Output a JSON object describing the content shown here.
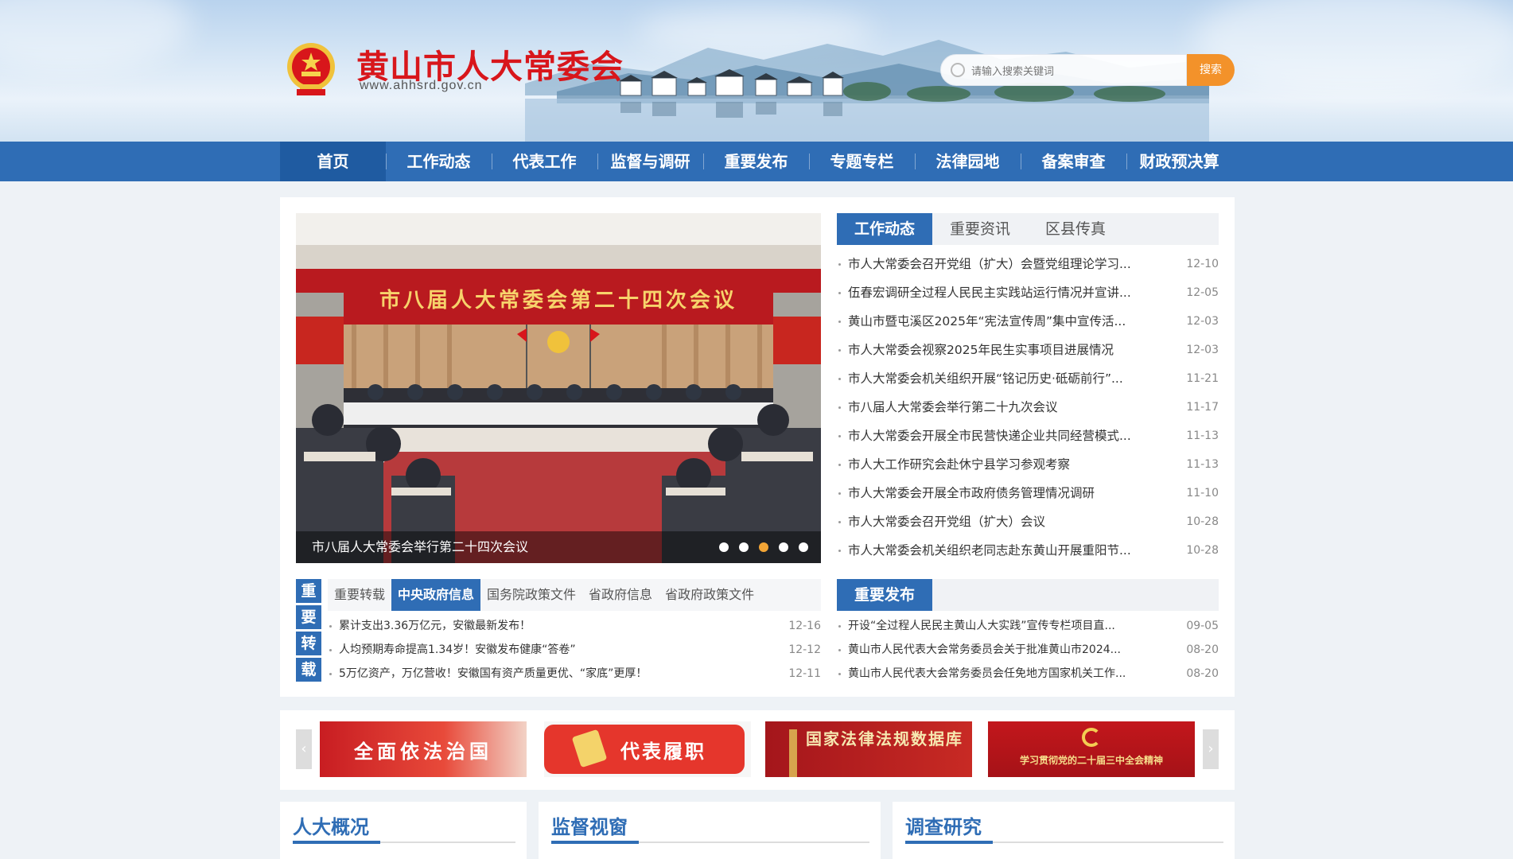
{
  "header": {
    "site_title": "黄山市人大常委会",
    "site_domain": "www.ahhsrd.gov.cn",
    "search_placeholder": "请输入搜索关键词",
    "search_button": "搜索"
  },
  "nav": [
    {
      "label": "首页",
      "active": true
    },
    {
      "label": "工作动态"
    },
    {
      "label": "代表工作"
    },
    {
      "label": "监督与调研"
    },
    {
      "label": "重要发布"
    },
    {
      "label": "专题专栏"
    },
    {
      "label": "法律园地"
    },
    {
      "label": "备案审查"
    },
    {
      "label": "财政预决算"
    }
  ],
  "slider": {
    "banner_text": "市八届人大常委会第二十四次会议",
    "caption": "市八届人大常委会举行第二十四次会议",
    "active_dot": 2,
    "dot_count": 5
  },
  "news_tabs": [
    "工作动态",
    "重要资讯",
    "区县传真"
  ],
  "news": [
    {
      "title": "市人大常委会召开党组（扩大）会暨党组理论学习...",
      "date": "12-10"
    },
    {
      "title": "伍春宏调研全过程人民民主实践站运行情况并宣讲...",
      "date": "12-05"
    },
    {
      "title": "黄山市暨屯溪区2025年“宪法宣传周”集中宣传活...",
      "date": "12-03"
    },
    {
      "title": "市人大常委会视察2025年民生实事项目进展情况",
      "date": "12-03"
    },
    {
      "title": "市人大常委会机关组织开展“铭记历史·砥砺前行”...",
      "date": "11-21"
    },
    {
      "title": "市八届人大常委会举行第二十九次会议",
      "date": "11-17"
    },
    {
      "title": "市人大常委会开展全市民营快递企业共同经营模式...",
      "date": "11-13"
    },
    {
      "title": "市人大工作研究会赴休宁县学习参观考察",
      "date": "11-13"
    },
    {
      "title": "市人大常委会开展全市政府债务管理情况调研",
      "date": "11-10"
    },
    {
      "title": "市人大常委会召开党组（扩大）会议",
      "date": "10-28"
    },
    {
      "title": "市人大常委会机关组织老同志赴东黄山开展重阳节...",
      "date": "10-28"
    }
  ],
  "repost": {
    "vertical_label": [
      "重",
      "要",
      "转",
      "载"
    ],
    "tabs": [
      "重要转载",
      "中央政府信息",
      "国务院政策文件",
      "省政府信息",
      "省政府政策文件"
    ],
    "active_tab": 1,
    "items": [
      {
        "title": "累计支出3.36万亿元，安徽最新发布！",
        "date": "12-16"
      },
      {
        "title": "人均预期寿命提高1.34岁！安徽发布健康“答卷”",
        "date": "12-12"
      },
      {
        "title": "5万亿资产，万亿营收！安徽国有资产质量更优、“家底”更厚！",
        "date": "12-11"
      }
    ]
  },
  "releases": {
    "tab": "重要发布",
    "items": [
      {
        "title": "开设“全过程人民民主黄山人大实践”宣传专栏项目直...",
        "date": "09-05"
      },
      {
        "title": "黄山市人民代表大会常务委员会关于批准黄山市2024...",
        "date": "08-20"
      },
      {
        "title": "黄山市人民代表大会常务委员会任免地方国家机关工作...",
        "date": "08-20"
      }
    ]
  },
  "banners": [
    {
      "text": "全面依法治国"
    },
    {
      "text": "代表履职"
    },
    {
      "text": "国家法律法规数据库"
    },
    {
      "text": "学习贯彻党的二十届三中全会精神"
    }
  ],
  "sections": [
    "人大概况",
    "监督视窗",
    "调查研究"
  ],
  "colors": {
    "primary": "#2f6db5",
    "accent_orange": "#f3922a",
    "title_red": "#d8161b"
  }
}
